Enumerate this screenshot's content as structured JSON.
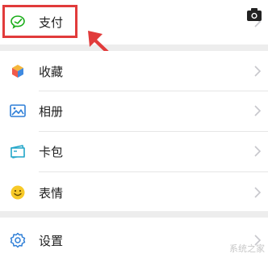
{
  "menu": {
    "items": [
      {
        "label": "支付",
        "icon": "wechat-pay-icon"
      },
      {
        "label": "收藏",
        "icon": "favorites-cube-icon"
      },
      {
        "label": "相册",
        "icon": "album-icon"
      },
      {
        "label": "卡包",
        "icon": "card-wallet-icon"
      },
      {
        "label": "表情",
        "icon": "emoji-icon"
      },
      {
        "label": "设置",
        "icon": "settings-gear-icon"
      }
    ]
  },
  "watermark": {
    "text": "系统之家"
  },
  "colors": {
    "highlight": "#e13b3b",
    "pay_green": "#1aad19",
    "cube_red": "#f05a4a",
    "cube_yellow": "#f5b63b",
    "cube_blue": "#3f8ae0",
    "icon_blue": "#2f7fd7",
    "emoji_yellow": "#f7c928",
    "settings_blue": "#2f7fd7"
  }
}
